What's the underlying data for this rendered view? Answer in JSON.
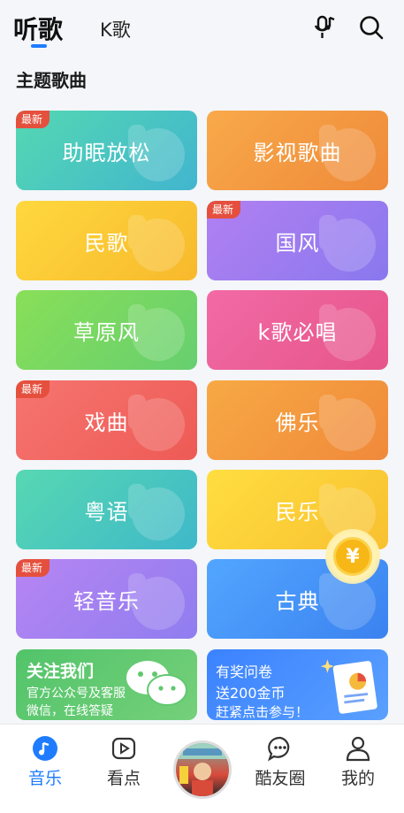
{
  "header": {
    "tab_active": "听歌",
    "tab_k": "K歌",
    "icons": [
      "mic-note-icon",
      "search-icon"
    ]
  },
  "section": {
    "title": "主题歌曲"
  },
  "cards": [
    {
      "label": "助眠放松",
      "badge": "最新",
      "color_from": "#54d8b2",
      "color_to": "#42b5cf"
    },
    {
      "label": "影视歌曲",
      "badge": "",
      "color_from": "#f8a94a",
      "color_to": "#ef8a3a"
    },
    {
      "label": "民歌",
      "badge": "",
      "color_from": "#ffd83e",
      "color_to": "#f7b92c"
    },
    {
      "label": "国风",
      "badge": "最新",
      "color_from": "#b180f2",
      "color_to": "#8a78ee"
    },
    {
      "label": "草原风",
      "badge": "",
      "color_from": "#89df58",
      "color_to": "#66cf6f"
    },
    {
      "label": "k歌必唱",
      "badge": "",
      "color_from": "#f26aa5",
      "color_to": "#e6558a"
    },
    {
      "label": "戏曲",
      "badge": "最新",
      "color_from": "#f67570",
      "color_to": "#ee5a55"
    },
    {
      "label": "佛乐",
      "badge": "",
      "color_from": "#f7a944",
      "color_to": "#f0893b"
    },
    {
      "label": "粤语",
      "badge": "",
      "color_from": "#57d8b2",
      "color_to": "#3fb8c9"
    },
    {
      "label": "民乐",
      "badge": "",
      "color_from": "#ffde40",
      "color_to": "#f8c030"
    },
    {
      "label": "轻音乐",
      "badge": "最新",
      "color_from": "#b785f2",
      "color_to": "#8f7df0"
    },
    {
      "label": "古典",
      "badge": "",
      "color_from": "#52a6ff",
      "color_to": "#3b82f0"
    }
  ],
  "promo": {
    "left": {
      "title": "关注我们",
      "sub": "官方公众号及客服微信，在线答疑"
    },
    "right": {
      "line1": "有奖问卷",
      "line2": "送200金币",
      "line3": "赶紧点击参与！"
    }
  },
  "coin": {
    "symbol": "¥"
  },
  "nav": {
    "items": [
      {
        "label": "音乐",
        "icon": "music-note-icon",
        "active": true
      },
      {
        "label": "看点",
        "icon": "play-square-icon",
        "active": false
      },
      {
        "label": "酷友圈",
        "icon": "chat-bubble-icon",
        "active": false
      },
      {
        "label": "我的",
        "icon": "person-icon",
        "active": false
      }
    ]
  },
  "colors": {
    "accent": "#1f7cff",
    "badge": "#e5503e"
  }
}
